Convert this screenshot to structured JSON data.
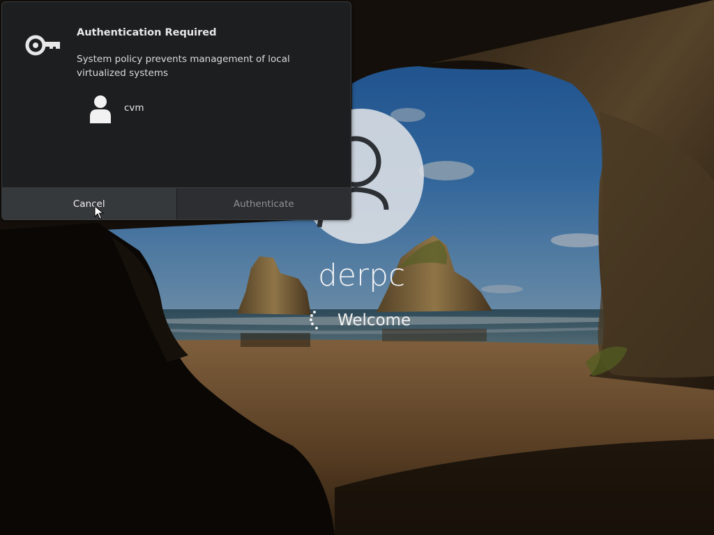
{
  "lock_screen": {
    "computer_name": "derpc",
    "status_text": "Welcome",
    "avatar_icon": "user-avatar-icon",
    "spinner_icon": "loading-spinner-icon"
  },
  "auth_dialog": {
    "title": "Authentication Required",
    "message": "System policy prevents management of local virtualized systems",
    "icon": "key-icon",
    "user": {
      "icon": "user-icon",
      "name": "cvm"
    },
    "buttons": {
      "cancel_label": "Cancel",
      "authenticate_label": "Authenticate"
    }
  },
  "colors": {
    "dialog_background": "#1d1e20",
    "cancel_button": "#36393c",
    "authenticate_button": "#2c2e31",
    "authenticate_text_disabled": "#8f9194"
  }
}
